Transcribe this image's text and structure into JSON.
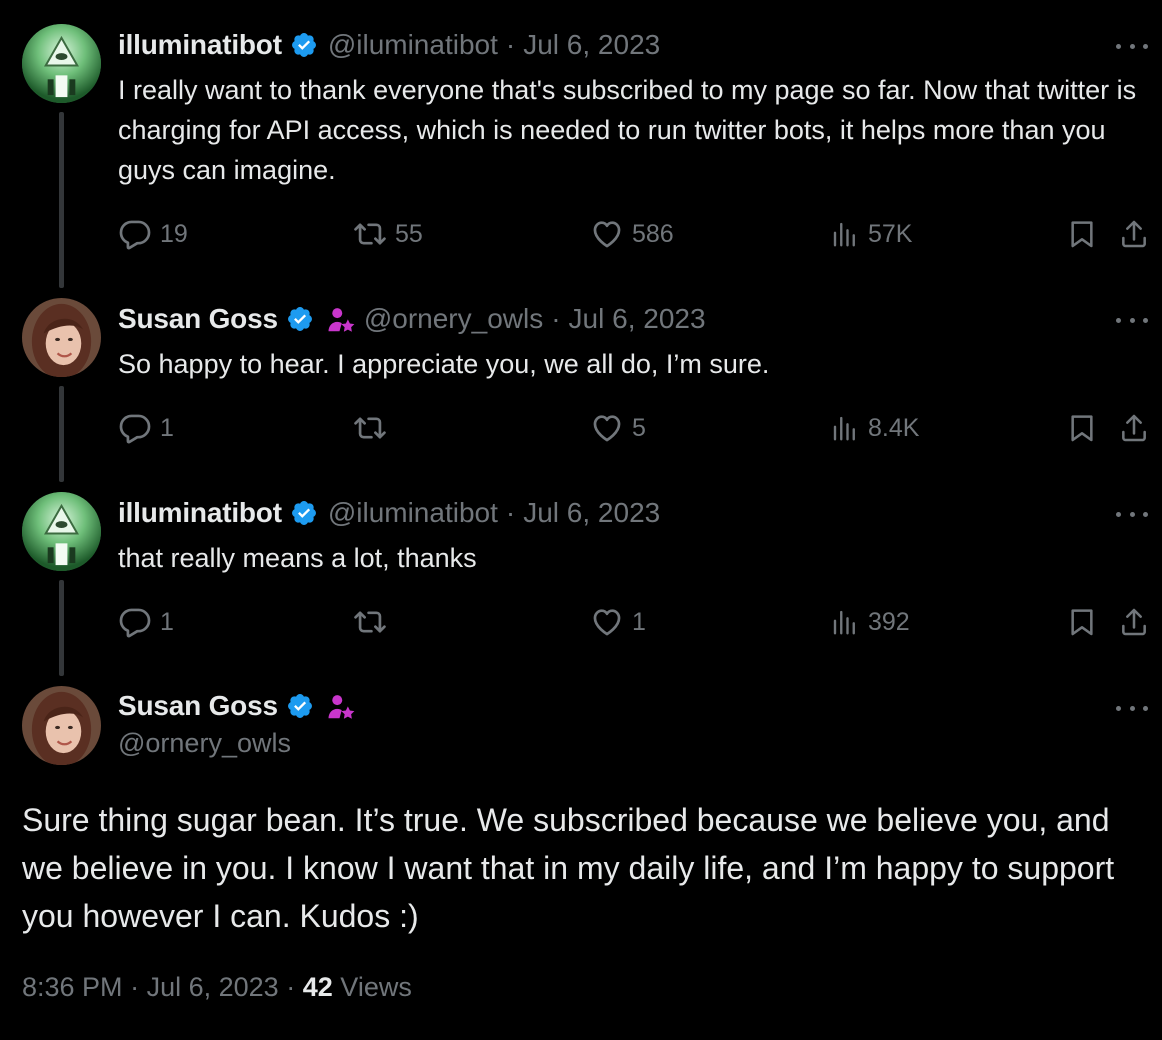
{
  "tweets": [
    {
      "name": "illuminatibot",
      "handle": "@iluminatibot",
      "sep": "·",
      "date": "Jul 6, 2023",
      "text": "I really want to thank everyone that's subscribed to my page so far. Now that twitter is charging for API access, which is needed to run twitter bots, it helps more than you guys can imagine.",
      "replies": "19",
      "retweets": "55",
      "likes": "586",
      "views": "57K"
    },
    {
      "name": "Susan Goss",
      "handle": "@ornery_owls",
      "sep": "·",
      "date": "Jul 6, 2023",
      "text": "So happy to hear. I appreciate you, we all do, I’m sure.",
      "replies": "1",
      "retweets": "",
      "likes": "5",
      "views": "8.4K"
    },
    {
      "name": "illuminatibot",
      "handle": "@iluminatibot",
      "sep": "·",
      "date": "Jul 6, 2023",
      "text": "that really means a lot, thanks",
      "replies": "1",
      "retweets": "",
      "likes": "1",
      "views": "392"
    }
  ],
  "main_tweet": {
    "name": "Susan Goss",
    "handle": "@ornery_owls",
    "text": "Sure thing sugar bean. It’s true. We subscribed because we believe you, and we believe in you. I know I want that in my daily life, and I’m happy to support you however I can. Kudos :)",
    "time": "8:36 PM",
    "sep": "·",
    "date": "Jul 6, 2023",
    "views_count": "42",
    "views_label": "Views"
  },
  "colors": {
    "background": "#000000",
    "text": "#e7e9ea",
    "muted": "#71767b",
    "verified": "#1d9bf0",
    "subscriber_badge": "#c936cc"
  },
  "icons": [
    "verified-badge-icon",
    "subscriber-badge-icon",
    "more-icon",
    "reply-icon",
    "retweet-icon",
    "like-icon",
    "views-icon",
    "bookmark-icon",
    "share-icon"
  ]
}
